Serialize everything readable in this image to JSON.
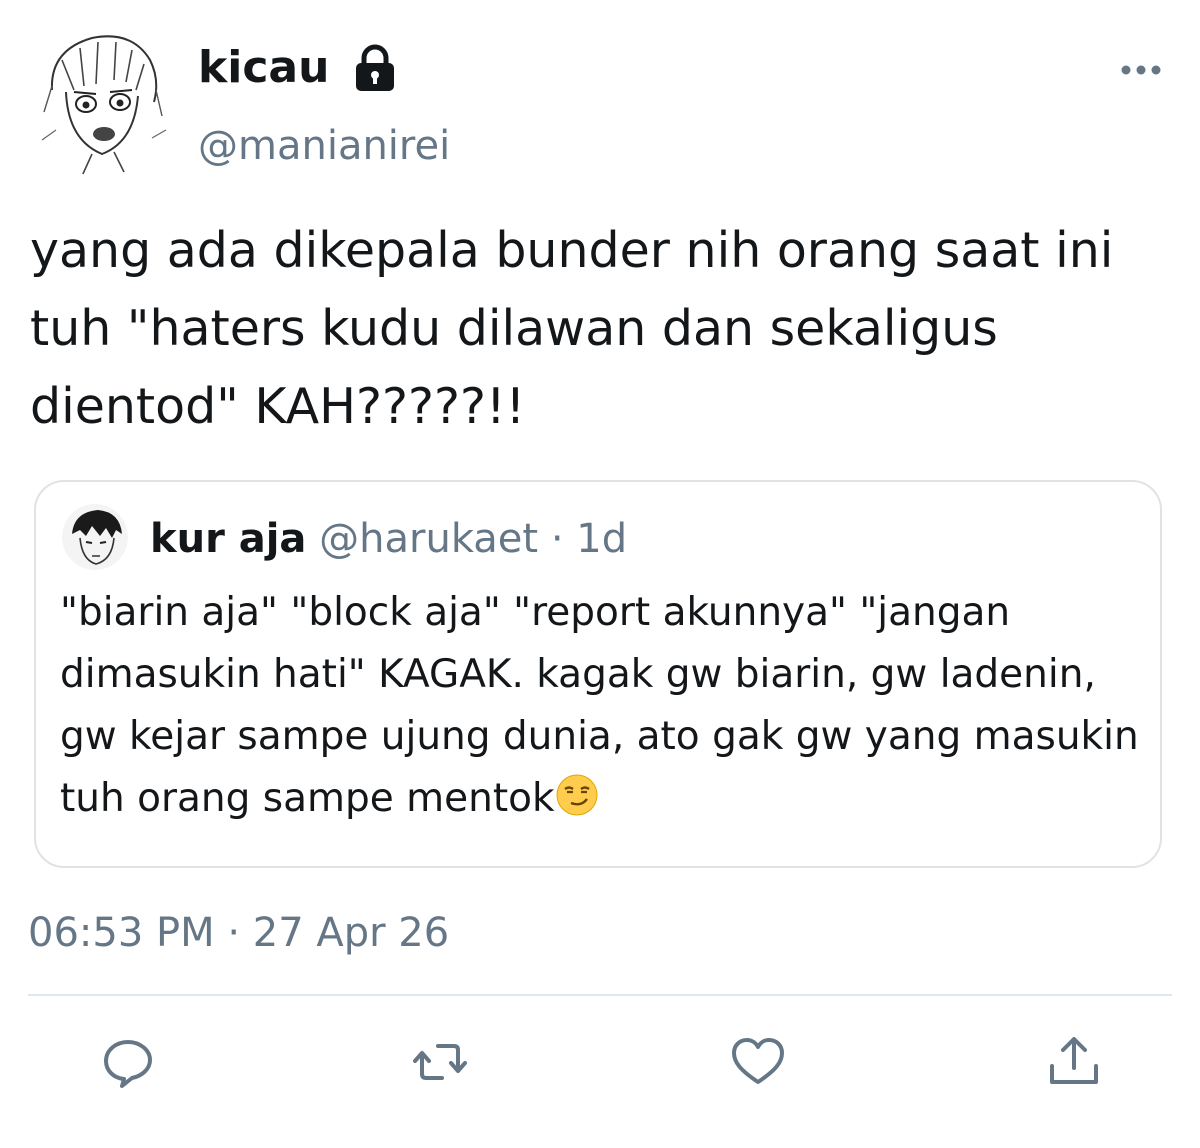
{
  "author": {
    "display_name": "kicau",
    "handle": "@manianirei",
    "protected": true
  },
  "tweet": {
    "text": "yang ada dikepala bunder nih orang saat ini tuh \"haters kudu dilawan dan sekaligus dientod\" KAH?????!!",
    "time": "06:53 PM",
    "date": "27 Apr 26",
    "separator": "·"
  },
  "quoted_tweet": {
    "display_name": "kur aja",
    "handle": "@harukaet",
    "separator": "·",
    "time_ago": "1d",
    "text": "\"biarin aja\" \"block aja\" \"report akunnya\" \"jangan dimasukin hati\" KAGAK. kagak gw biarin, gw ladenin, gw kejar sampe ujung dunia, ato gak gw yang masukin tuh orang sampe mentok",
    "trailing_emoji": "smirking-face-emoji"
  },
  "actions": [
    "reply-icon",
    "retweet-icon",
    "like-icon",
    "share-icon"
  ],
  "colors": {
    "text_primary": "#14171a",
    "text_secondary": "#657786",
    "border": "#dfe3e6",
    "icon": "#657786"
  }
}
